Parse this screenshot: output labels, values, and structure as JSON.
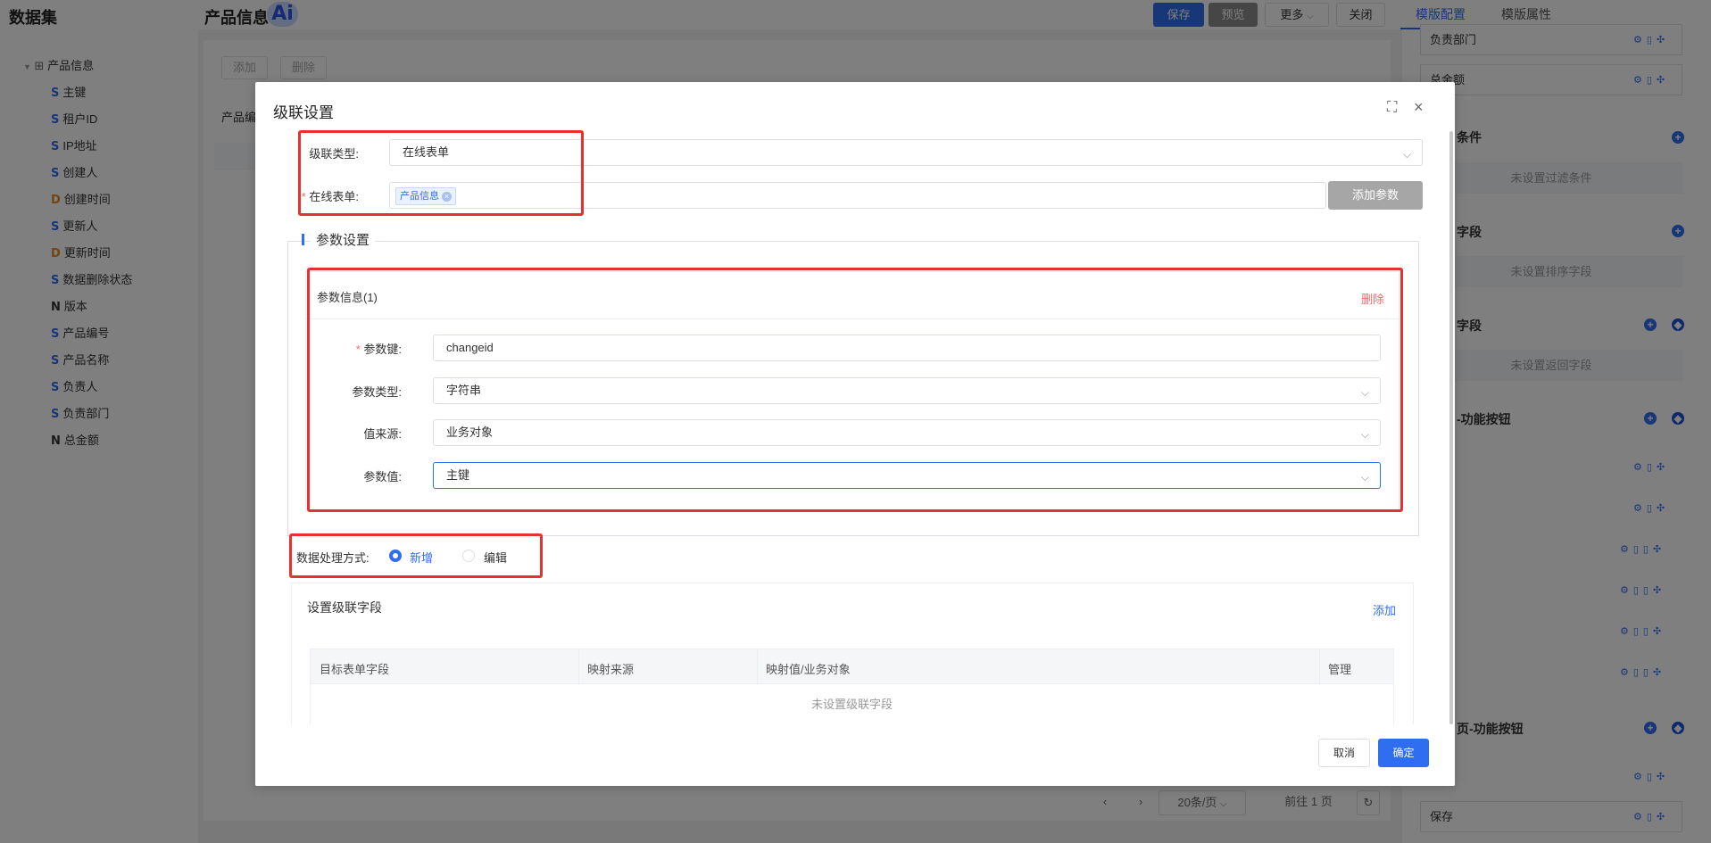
{
  "app": {
    "dataset_title": "数据集",
    "page_title": "产品信息",
    "ai_badge": "Ai"
  },
  "toolbar": {
    "save": "保存",
    "preview": "预览",
    "more": "更多",
    "close": "关闭"
  },
  "right_tabs": {
    "template_config": "模版配置",
    "template_props": "模版属性"
  },
  "tree": {
    "root": "产品信息",
    "items": [
      {
        "type": "S",
        "label": "主键"
      },
      {
        "type": "S",
        "label": "租户ID"
      },
      {
        "type": "S",
        "label": "IP地址"
      },
      {
        "type": "S",
        "label": "创建人"
      },
      {
        "type": "D",
        "label": "创建时间"
      },
      {
        "type": "S",
        "label": "更新人"
      },
      {
        "type": "D",
        "label": "更新时间"
      },
      {
        "type": "S",
        "label": "数据删除状态"
      },
      {
        "type": "N",
        "label": "版本"
      },
      {
        "type": "S",
        "label": "产品编号"
      },
      {
        "type": "S",
        "label": "产品名称"
      },
      {
        "type": "S",
        "label": "负责人"
      },
      {
        "type": "S",
        "label": "负责部门"
      },
      {
        "type": "N",
        "label": "总金额"
      }
    ]
  },
  "center_bg": {
    "add": "添加",
    "delete": "删除",
    "label": "产品编"
  },
  "right_panel": {
    "card1": "负责部门",
    "card2": "总金额",
    "sec_filter": "条件",
    "empty_filter": "未设置过滤条件",
    "sec_sort": "字段",
    "empty_sort": "未设置排序字段",
    "sec_return": "字段",
    "empty_return": "未设置返回字段",
    "sec_buttons": "-功能按钮",
    "sec_buttons2": "页-功能按钮",
    "last_card": "保存"
  },
  "pagination": {
    "page_size": "20条/页",
    "goto": "前往",
    "page": "1",
    "page_unit": "页"
  },
  "modal": {
    "title": "级联设置",
    "cascade_type_label": "级联类型:",
    "cascade_type_value": "在线表单",
    "online_form_label": "在线表单:",
    "online_form_tag": "产品信息",
    "add_param": "添加参数",
    "param_section": "参数设置",
    "param_card_title": "参数信息(1)",
    "param_delete": "删除",
    "param_key_label": "参数键:",
    "param_key_value": "changeid",
    "param_type_label": "参数类型:",
    "param_type_value": "字符串",
    "value_source_label": "值来源:",
    "value_source_value": "业务对象",
    "param_value_label": "参数值:",
    "param_value_value": "主键",
    "process_label": "数据处理方式:",
    "radio_add": "新增",
    "radio_edit": "编辑",
    "cascade_fields_title": "设置级联字段",
    "cascade_fields_add": "添加",
    "table_headers": [
      "目标表单字段",
      "映射来源",
      "映射值/业务对象",
      "管理"
    ],
    "table_empty": "未设置级联字段",
    "cancel": "取消",
    "ok": "确定"
  },
  "colors": {
    "primary": "#2f6ef0",
    "danger": "#f56c6c",
    "highlight": "#e5312f"
  }
}
